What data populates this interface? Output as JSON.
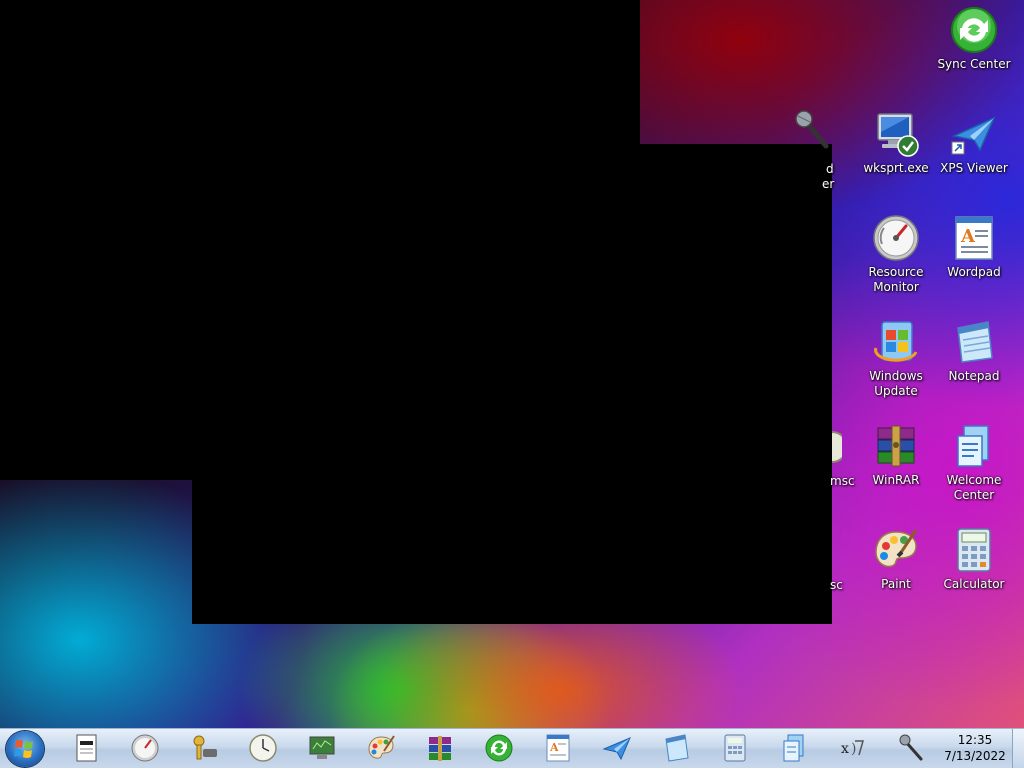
{
  "desktop": {
    "icons": [
      {
        "label": "Sync Center",
        "icon": "sync-icon"
      },
      {
        "label": "wksprt.exe",
        "icon": "remote-desktop-icon"
      },
      {
        "label": "XPS Viewer",
        "icon": "xps-viewer-icon"
      },
      {
        "label": "Resource Monitor",
        "icon": "gauge-icon"
      },
      {
        "label": "Wordpad",
        "icon": "wordpad-icon"
      },
      {
        "label": "Windows Update",
        "icon": "windows-update-icon"
      },
      {
        "label": "Notepad",
        "icon": "notepad-icon"
      },
      {
        "label": "WinRAR",
        "icon": "winrar-icon"
      },
      {
        "label": "Welcome Center",
        "icon": "welcome-center-icon"
      },
      {
        "label": "Paint",
        "icon": "paint-palette-icon"
      },
      {
        "label": "Calculator",
        "icon": "calculator-icon"
      }
    ],
    "partial_labels": {
      "sound_recorder_line1": "d",
      "sound_recorder_line2": "er",
      "msc_1": "msc",
      "msc_2": "sc"
    }
  },
  "taskbar": {
    "items": [
      "document-icon",
      "gauge-icon",
      "key-icon",
      "clock-icon",
      "monitor-icon",
      "paint-palette-icon",
      "winrar-icon",
      "sync-icon",
      "wordpad-icon",
      "xps-viewer-icon",
      "notepad-icon",
      "calculator-icon",
      "welcome-center-icon",
      "math-input-icon",
      "microphone-icon"
    ],
    "time": "12:35",
    "date": "7/13/2022"
  }
}
